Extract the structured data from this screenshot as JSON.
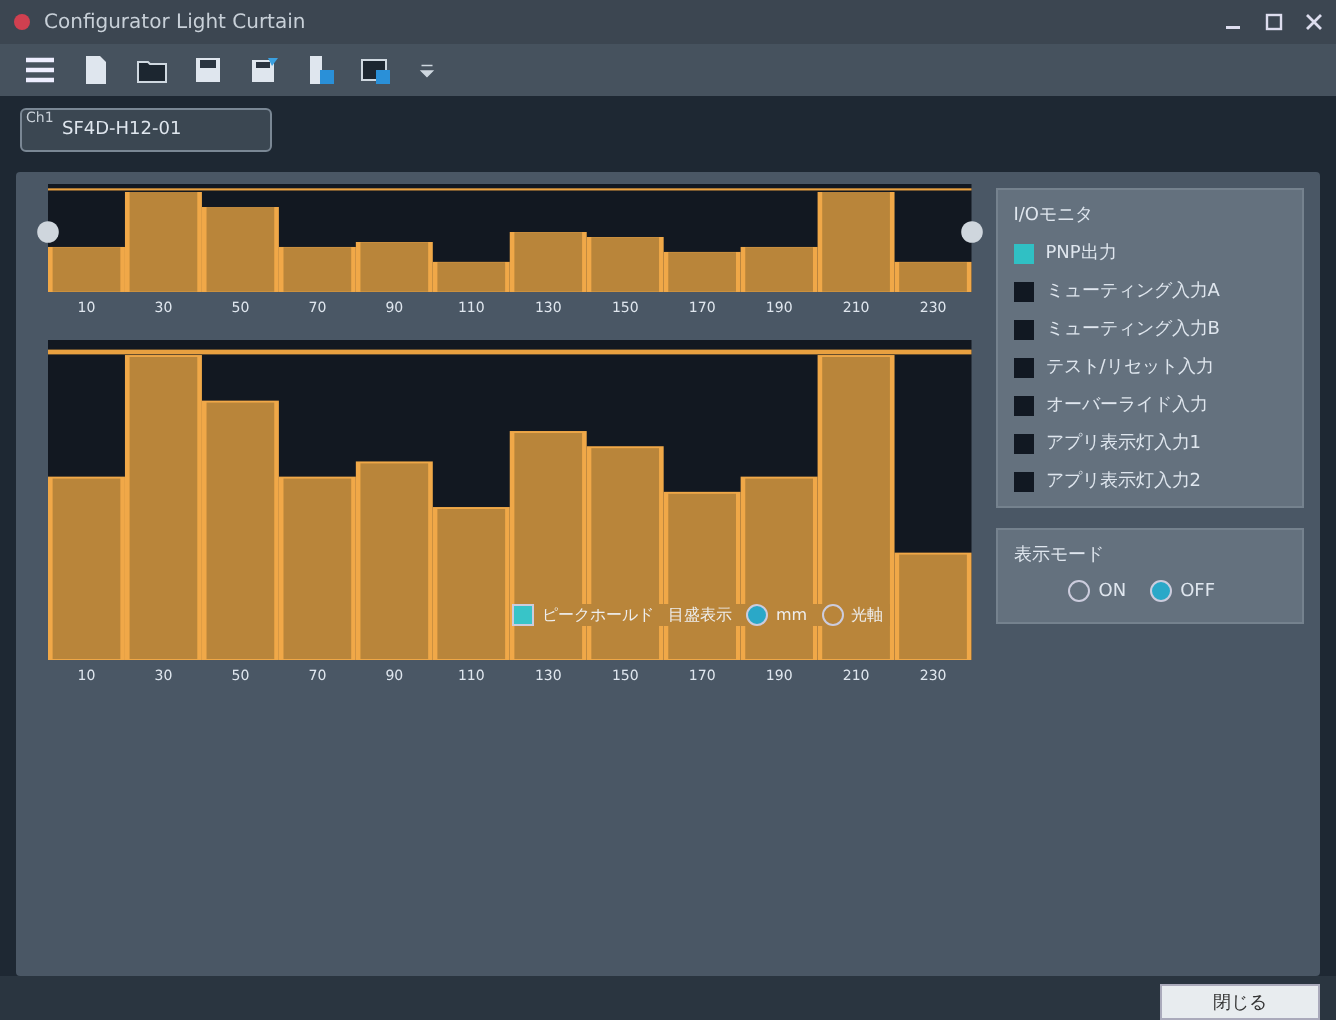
{
  "window": {
    "title": "Configurator Light Curtain"
  },
  "device": {
    "label": "Ch1",
    "value": "SF4D-H12-01"
  },
  "top_chart": {
    "axis_labels": [
      "10",
      "30",
      "50",
      "70",
      "90",
      "110",
      "130",
      "150",
      "170",
      "190",
      "210",
      "230"
    ]
  },
  "bottom_chart": {
    "axis_labels": [
      "10",
      "30",
      "50",
      "70",
      "90",
      "110",
      "130",
      "150",
      "170",
      "190",
      "210",
      "230"
    ],
    "peak_hold": {
      "label": "ピークホールド",
      "checked": true
    },
    "scale": {
      "label": "目盛表示",
      "options": [
        {
          "label": "mm",
          "selected": true
        },
        {
          "label": "光軸",
          "selected": false
        }
      ]
    }
  },
  "io_monitor": {
    "title": "I/Oモニタ",
    "items": [
      {
        "label": "PNP出力",
        "on": true
      },
      {
        "label": "ミューティング入力A",
        "on": false
      },
      {
        "label": "ミューティング入力B",
        "on": false
      },
      {
        "label": "テスト/リセット入力",
        "on": false
      },
      {
        "label": "オーバーライド入力",
        "on": false
      },
      {
        "label": "アプリ表示灯入力1",
        "on": false
      },
      {
        "label": "アプリ表示灯入力2",
        "on": false
      }
    ]
  },
  "display_mode": {
    "title": "表示モード",
    "options": [
      {
        "label": "ON",
        "selected": false
      },
      {
        "label": "OFF",
        "selected": true
      }
    ]
  },
  "close_button": "閉じる"
}
